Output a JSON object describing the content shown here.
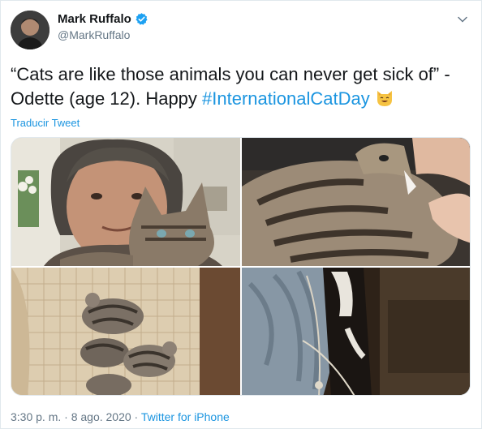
{
  "tweet": {
    "author_name": "Mark Ruffalo",
    "author_handle": "@MarkRuffalo",
    "text_before": "“Cats are like those animals you can never get sick of” - Odette (age 12). Happy ",
    "hashtag": "#InternationalCatDay",
    "translate_label": "Traducir Tweet",
    "timestamp": "3:30 p. m. · 8 ago. 2020 · ",
    "source": "Twitter for iPhone",
    "accent_color": "#1b95e0",
    "verified_color": "#1da1f2"
  },
  "icons": {
    "verified": "verified-badge-icon",
    "caret": "chevron-down-icon",
    "emoji": "smiling-cat-emoji-icon"
  },
  "media": {
    "photos": [
      {
        "name": "man-with-kitten-selfie"
      },
      {
        "name": "kitten-closeup"
      },
      {
        "name": "kittens-sleeping-on-chair"
      },
      {
        "name": "kitten-in-bag"
      }
    ]
  }
}
